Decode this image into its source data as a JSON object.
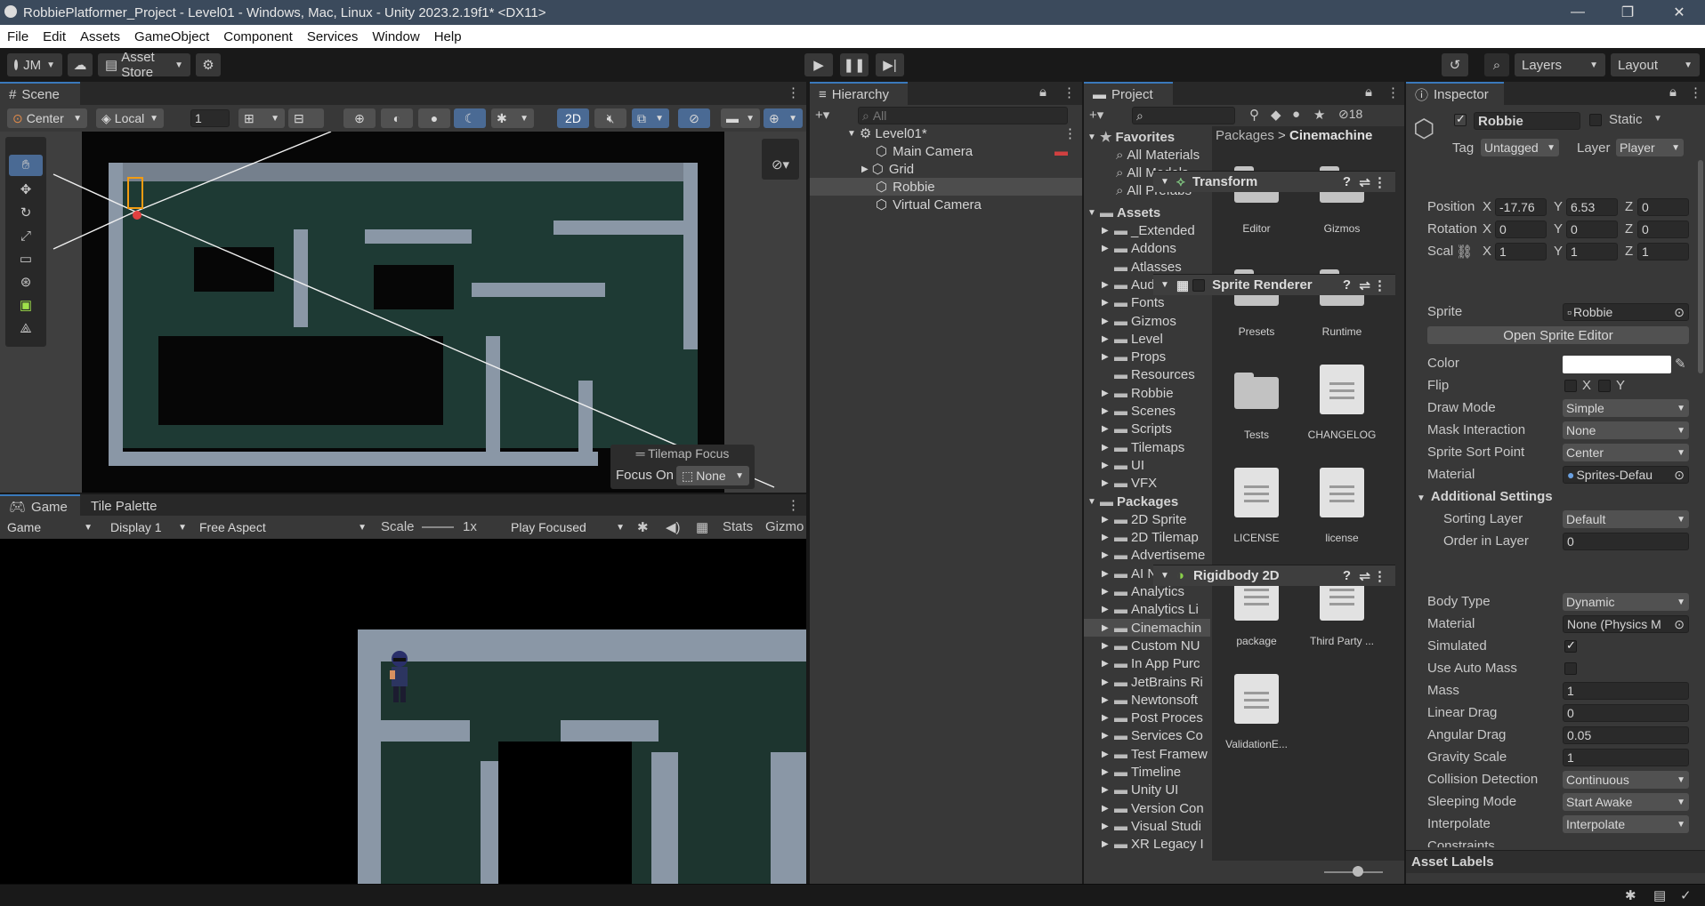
{
  "window": {
    "title": "RobbiePlatformer_Project - Level01 - Windows, Mac, Linux - Unity 2023.2.19f1* <DX11>",
    "min": "—",
    "max": "❐",
    "close": "✕"
  },
  "menu": [
    "File",
    "Edit",
    "Assets",
    "GameObject",
    "Component",
    "Services",
    "Window",
    "Help"
  ],
  "toolbar": {
    "account": "JM",
    "asset_store": "Asset Store",
    "layers": "Layers",
    "layout": "Layout"
  },
  "scene": {
    "tab": "Scene",
    "pivot": "Center",
    "space": "Local",
    "snap_value": "1",
    "mode_2d": "2D",
    "overlay_title": "Tilemap Focus",
    "focus_label": "Focus On",
    "focus_value": "None"
  },
  "game": {
    "tabs": [
      "Game",
      "Tile Palette"
    ],
    "display_mode": "Game",
    "display": "Display 1",
    "aspect": "Free Aspect",
    "scale_label": "Scale",
    "scale_value": "1x",
    "play_mode": "Play Focused",
    "stats": "Stats",
    "gizmos": "Gizmo"
  },
  "hierarchy": {
    "tab": "Hierarchy",
    "search_placeholder": "All",
    "scene": "Level01*",
    "items": [
      "Main Camera",
      "Grid",
      "Robbie",
      "Virtual Camera"
    ]
  },
  "project": {
    "tab": "Project",
    "hidden_count": "18",
    "favorites_label": "Favorites",
    "favorites": [
      "All Materials",
      "All Models",
      "All Prefabs"
    ],
    "assets_label": "Assets",
    "assets": [
      "_Extended",
      "Addons",
      "Atlasses",
      "Audio",
      "Fonts",
      "Gizmos",
      "Level",
      "Props",
      "Resources",
      "Robbie",
      "Scenes",
      "Scripts",
      "Tilemaps",
      "UI",
      "VFX"
    ],
    "packages_label": "Packages",
    "packages": [
      "2D Sprite",
      "2D Tilemap",
      "Advertiseme",
      "AI Navigatio",
      "Analytics",
      "Analytics Li",
      "Cinemachin",
      "Custom NU",
      "In App Purc",
      "JetBrains Ri",
      "Newtonsoft",
      "Post Proces",
      "Services Co",
      "Test Framew",
      "Timeline",
      "Unity UI",
      "Version Con",
      "Visual Studi",
      "XR Legacy I"
    ],
    "breadcrumb_root": "Packages",
    "breadcrumb_current": "Cinemachine",
    "folders": [
      "Editor",
      "Gizmos",
      "Presets",
      "Runtime",
      "Tests"
    ],
    "files": [
      "CHANGELOG",
      "LICENSE",
      "license",
      "package",
      "Third Party ...",
      "ValidationE..."
    ]
  },
  "inspector": {
    "tab": "Inspector",
    "object_name": "Robbie",
    "static_label": "Static",
    "tag_label": "Tag",
    "tag": "Untagged",
    "layer_label": "Layer",
    "layer": "Player",
    "transform": {
      "title": "Transform",
      "position_label": "Position",
      "rotation_label": "Rotation",
      "scale_label": "Scal",
      "position": [
        "-17.76",
        "6.53",
        "0"
      ],
      "rotation": [
        "0",
        "0",
        "0"
      ],
      "scale": [
        "1",
        "1",
        "1"
      ],
      "axes": [
        "X",
        "Y",
        "Z"
      ]
    },
    "sprite_renderer": {
      "title": "Sprite Renderer",
      "sprite_label": "Sprite",
      "sprite": "Robbie",
      "open_editor": "Open Sprite Editor",
      "color_label": "Color",
      "flip_label": "Flip",
      "flip_x": "X",
      "flip_y": "Y",
      "draw_mode_label": "Draw Mode",
      "draw_mode": "Simple",
      "mask_label": "Mask Interaction",
      "mask": "None",
      "sort_point_label": "Sprite Sort Point",
      "sort_point": "Center",
      "material_label": "Material",
      "material": "Sprites-Defau",
      "additional": "Additional Settings",
      "sorting_layer_label": "Sorting Layer",
      "sorting_layer": "Default",
      "order_label": "Order in Layer",
      "order": "0"
    },
    "rigidbody": {
      "title": "Rigidbody 2D",
      "body_type_label": "Body Type",
      "body_type": "Dynamic",
      "material_label": "Material",
      "material": "None (Physics M",
      "simulated_label": "Simulated",
      "auto_mass_label": "Use Auto Mass",
      "mass_label": "Mass",
      "mass": "1",
      "linear_drag_label": "Linear Drag",
      "linear_drag": "0",
      "angular_drag_label": "Angular Drag",
      "angular_drag": "0.05",
      "gravity_label": "Gravity Scale",
      "gravity": "1",
      "collision_label": "Collision Detection",
      "collision": "Continuous",
      "sleeping_label": "Sleeping Mode",
      "sleeping": "Start Awake",
      "interpolate_label": "Interpolate",
      "interpolate": "Interpolate",
      "constraints_label": "Constraints"
    },
    "asset_labels": "Asset Labels"
  },
  "colors": {
    "accent": "#3a79bb",
    "panel": "#383838",
    "dark": "#191919",
    "title": "#3b4a5c"
  }
}
